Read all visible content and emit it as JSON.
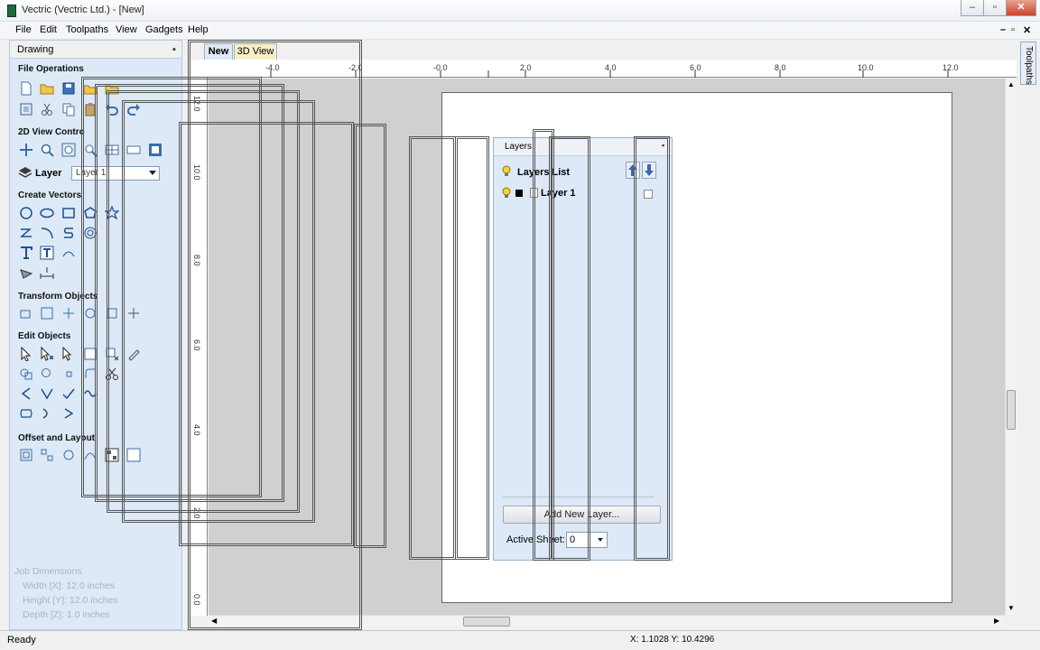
{
  "window": {
    "title": "Vectric (Vectric Ltd.) - [New]"
  },
  "title_buttons": {
    "minimize": "–",
    "restore": "▫",
    "close": "✕"
  },
  "menu": [
    "File",
    "Edit",
    "Toolpaths",
    "View",
    "Gadgets",
    "Help"
  ],
  "mdi_buttons": {
    "minimize": "–",
    "restore": "▫",
    "close": "✕"
  },
  "drawing_panel": {
    "title": "Drawing",
    "sections": {
      "file_operations": "File Operations",
      "view_control": "2D View Contro",
      "create_vectors": "Create Vectors",
      "transform_objects": "Transform Objects",
      "edit_objects": "Edit Objects",
      "offset_layout": "Offset and Layout"
    },
    "layer_label": "Layer",
    "layer_value": "Layer 1",
    "job_dimensions": {
      "title": "Job Dimensions",
      "width": "Width  [X]: 12.0 inches",
      "height": "Height [Y]: 12.0 inches",
      "depth": "Depth  [Z]: 1.0 inches"
    }
  },
  "tabs": [
    "New",
    "3D View"
  ],
  "ruler": {
    "h_labels": [
      "-4.0",
      "-2.0",
      "-0.0",
      "2.0",
      "4.0",
      "6.0",
      "8.0",
      "10.0",
      "12.0"
    ],
    "v_labels": [
      "12.0",
      "10.0",
      "8.0",
      "6.0",
      "4.0",
      "2.0",
      "0.0"
    ]
  },
  "toolpaths_tab": "Toolpaths",
  "layers_panel": {
    "title": "Layers",
    "list_header": "Layers List",
    "layers": [
      {
        "name": "Layer 1"
      }
    ],
    "add_button": "Add New Layer...",
    "active_sheet_label": "Active Sheet:",
    "active_sheet_value": "0"
  },
  "status": {
    "text": "Ready",
    "coords": "X: 1.1028 Y: 10.4296"
  },
  "colors": {
    "panel_bg": "#dde9f7",
    "accent": "#3a6ea5",
    "tab_active": "#dfe9f6",
    "tab_3d": "#f8efc9"
  }
}
